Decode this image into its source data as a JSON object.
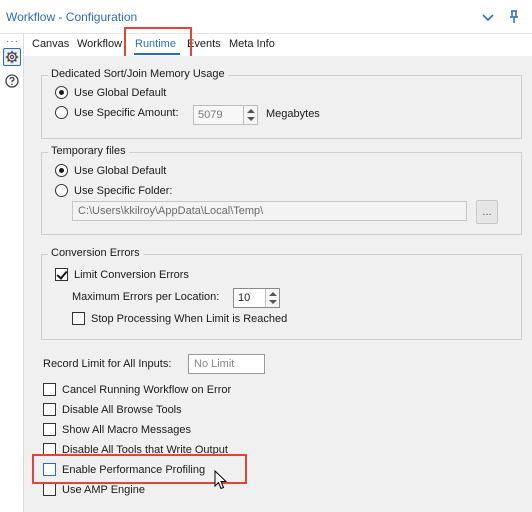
{
  "window": {
    "title": "Workflow - Configuration",
    "collapse_icon": "chevron-down-icon",
    "pin_icon": "pin-icon"
  },
  "sidebar": {
    "more_label": "···",
    "items": [
      {
        "icon": "gear-icon",
        "active": true
      },
      {
        "icon": "help-icon",
        "active": false
      }
    ]
  },
  "tabs": [
    {
      "label": "Canvas",
      "active": false
    },
    {
      "label": "Workflow",
      "active": false
    },
    {
      "label": "Runtime",
      "active": true
    },
    {
      "label": "Events",
      "active": false
    },
    {
      "label": "Meta Info",
      "active": false
    }
  ],
  "sort_join": {
    "legend": "Dedicated Sort/Join Memory Usage",
    "global_label": "Use Global Default",
    "global_selected": true,
    "specific_label": "Use Specific Amount:",
    "specific_selected": false,
    "amount_value": "5079",
    "unit_label": "Megabytes"
  },
  "temp_files": {
    "legend": "Temporary files",
    "global_label": "Use Global Default",
    "global_selected": true,
    "folder_label": "Use Specific Folder:",
    "folder_selected": false,
    "folder_path": "C:\\Users\\kkilroy\\AppData\\Local\\Temp\\",
    "browse_label": "..."
  },
  "conversion": {
    "legend": "Conversion Errors",
    "limit_label": "Limit Conversion Errors",
    "limit_checked": true,
    "max_label": "Maximum Errors per Location:",
    "max_value": "10",
    "stop_label": "Stop Processing When Limit is Reached",
    "stop_checked": false
  },
  "record_limit": {
    "label": "Record Limit for All Inputs:",
    "placeholder": "No Limit"
  },
  "options": [
    {
      "label": "Cancel Running Workflow on Error",
      "checked": false
    },
    {
      "label": "Disable All Browse Tools",
      "checked": false
    },
    {
      "label": "Show All Macro Messages",
      "checked": false
    },
    {
      "label": "Disable All Tools that Write Output",
      "checked": false
    },
    {
      "label": "Enable Performance Profiling",
      "checked": false
    },
    {
      "label": "Use AMP Engine",
      "checked": false
    }
  ],
  "colors": {
    "accent": "#2a6ebb",
    "highlight": "#e0443a",
    "panel_bg": "#f0f0f0"
  }
}
